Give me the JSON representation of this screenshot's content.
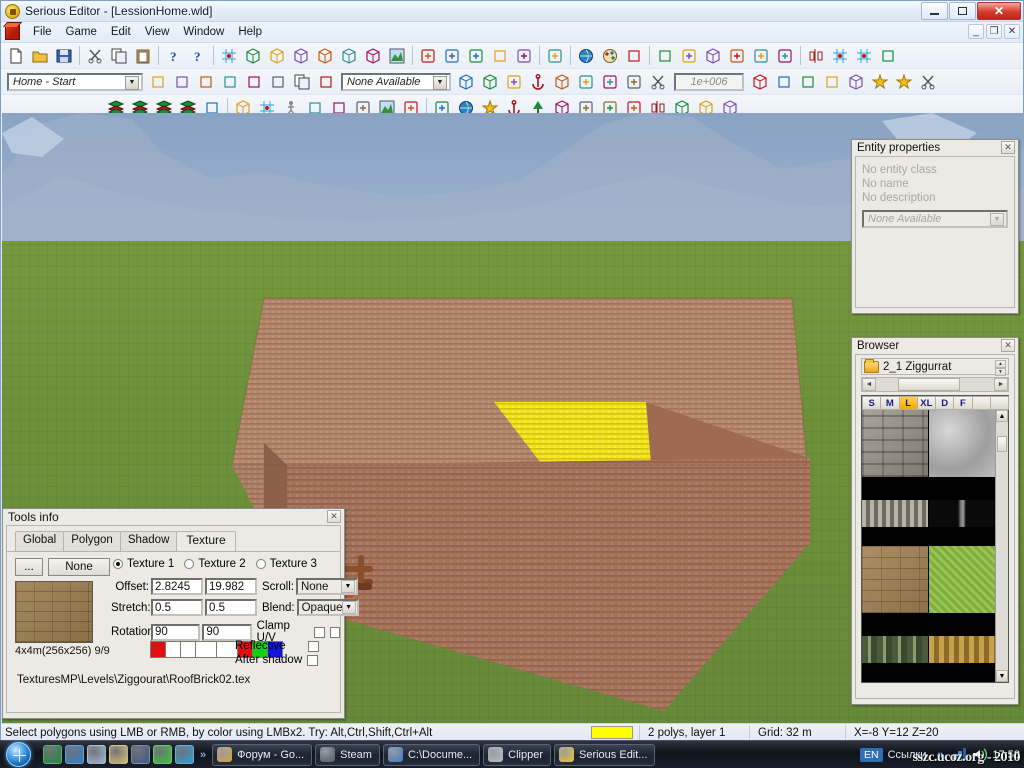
{
  "window": {
    "title": "Serious Editor - [LessionHome.wld]",
    "app_icon": "serious-sam-icon",
    "controls": {
      "minimize": "–",
      "restore": "❐",
      "close": "✕"
    },
    "mdi_controls": {
      "minimize": "_",
      "restore": "❐",
      "close": "✕"
    }
  },
  "menu": {
    "items": [
      "File",
      "Game",
      "Edit",
      "View",
      "Window",
      "Help"
    ]
  },
  "toolbars": {
    "row1": [
      {
        "name": "new-file-icon",
        "glyph": "page"
      },
      {
        "name": "open-file-icon",
        "glyph": "folder"
      },
      {
        "name": "save-file-icon",
        "glyph": "disk"
      },
      {
        "name": "separator"
      },
      {
        "name": "cut-icon",
        "glyph": "scissors"
      },
      {
        "name": "copy-icon",
        "glyph": "copy"
      },
      {
        "name": "paste-icon",
        "glyph": "clipboard"
      },
      {
        "name": "separator"
      },
      {
        "name": "help-icon",
        "glyph": "question"
      },
      {
        "name": "context-help-icon",
        "glyph": "arrow-question"
      },
      {
        "name": "separator"
      },
      {
        "name": "grid-mode-icon",
        "glyph": "grid"
      },
      {
        "name": "vertex-mode-icon",
        "glyph": "vertex"
      },
      {
        "name": "edge-mode-icon",
        "glyph": "edge"
      },
      {
        "name": "polygon-mode-icon",
        "glyph": "poly"
      },
      {
        "name": "sector-mode-icon",
        "glyph": "sector"
      },
      {
        "name": "brush-mode-icon",
        "glyph": "brush"
      },
      {
        "name": "entity-mode-icon",
        "glyph": "entity"
      },
      {
        "name": "terrain-mode-icon",
        "glyph": "terrain"
      },
      {
        "name": "separator"
      },
      {
        "name": "csg-add-icon",
        "glyph": "csg"
      },
      {
        "name": "csg-tool-icon",
        "glyph": "csgtool"
      },
      {
        "name": "measure-icon",
        "glyph": "1m"
      },
      {
        "name": "screenshot-icon",
        "glyph": "camera"
      },
      {
        "name": "render-icon",
        "glyph": "render"
      },
      {
        "name": "separator"
      },
      {
        "name": "shadow-calc-icon",
        "glyph": "shadow"
      },
      {
        "name": "separator"
      },
      {
        "name": "world-icon",
        "glyph": "globe"
      },
      {
        "name": "palette-icon",
        "glyph": "palette"
      },
      {
        "name": "texture-browser-icon",
        "glyph": "texbrowse"
      },
      {
        "name": "separator"
      },
      {
        "name": "view-wire-icon",
        "glyph": "wire1"
      },
      {
        "name": "view-flat-icon",
        "glyph": "flat"
      },
      {
        "name": "view-solid-icon",
        "glyph": "solid"
      },
      {
        "name": "view-textured-icon",
        "glyph": "textured"
      },
      {
        "name": "view-lit-icon",
        "glyph": "lit"
      },
      {
        "name": "view-layout-icon",
        "glyph": "layout"
      },
      {
        "name": "separator"
      },
      {
        "name": "mirror-icon",
        "glyph": "mirror"
      },
      {
        "name": "snap-grid-icon",
        "glyph": "snapgrid"
      },
      {
        "name": "grid-size-icon",
        "glyph": "gridsize"
      },
      {
        "name": "color-select-icon",
        "glyph": "colorsel"
      }
    ],
    "row2": {
      "mode_combo_value": "Home - Start",
      "none_available_combo_value": "None Available",
      "quantity_field_value": "1e+006",
      "buttons": [
        {
          "name": "paint-texture-icon",
          "glyph": "paintbucket"
        },
        {
          "name": "texture-1-icon",
          "glyph": "tex1"
        },
        {
          "name": "texture-2-icon",
          "glyph": "tex2"
        },
        {
          "name": "texture-3-icon",
          "glyph": "tex3"
        },
        {
          "name": "texture-clear-icon",
          "glyph": "texclear"
        },
        {
          "name": "texture-random-icon",
          "glyph": "texrand"
        },
        {
          "name": "texture-copy-icon",
          "glyph": "texcopy"
        },
        {
          "name": "texture-apply-icon",
          "glyph": "texapply"
        },
        {
          "name": "brush-prev-icon",
          "glyph": "bprev"
        },
        {
          "name": "brush-next-icon",
          "glyph": "bnext"
        },
        {
          "name": "layer-icon",
          "glyph": "layer"
        },
        {
          "name": "anchor-tool-icon",
          "glyph": "anchortool"
        },
        {
          "name": "cube-tool-icon",
          "glyph": "cubetool"
        },
        {
          "name": "align-icon",
          "glyph": "align"
        },
        {
          "name": "plane-icon",
          "glyph": "plane"
        },
        {
          "name": "checker-icon",
          "glyph": "checker"
        },
        {
          "name": "scissors2-icon",
          "glyph": "scissors2"
        },
        {
          "name": "entity-place-icon",
          "glyph": "entplace"
        },
        {
          "name": "step-down-icon",
          "glyph": "stepdn"
        },
        {
          "name": "step-up-icon",
          "glyph": "stepup"
        },
        {
          "name": "light-add-icon",
          "glyph": "lightadd"
        },
        {
          "name": "box-light-icon",
          "glyph": "boxlight"
        },
        {
          "name": "spark-icon",
          "glyph": "spark"
        },
        {
          "name": "box-spark-icon",
          "glyph": "boxspark"
        },
        {
          "name": "cut-tool-icon",
          "glyph": "cuttool"
        }
      ]
    },
    "row3": [
      {
        "name": "layers-1-icon",
        "glyph": "layers1"
      },
      {
        "name": "layers-2-icon",
        "glyph": "layers2"
      },
      {
        "name": "layers-3-icon",
        "glyph": "layers3"
      },
      {
        "name": "layers-delete-icon",
        "glyph": "layersdel"
      },
      {
        "name": "paint-can-icon",
        "glyph": "paintcan"
      },
      {
        "name": "separator"
      },
      {
        "name": "new-brush-icon",
        "glyph": "newbrush"
      },
      {
        "name": "color-grid-icon",
        "glyph": "colorgrid"
      },
      {
        "name": "walk-icon",
        "glyph": "walk"
      },
      {
        "name": "select-rect-icon",
        "glyph": "selrect"
      },
      {
        "name": "select-all-icon",
        "glyph": "selall"
      },
      {
        "name": "snap-icon",
        "glyph": "snap"
      },
      {
        "name": "terrain-paint-icon",
        "glyph": "terpaint"
      },
      {
        "name": "align-left-icon",
        "glyph": "alignleft"
      },
      {
        "name": "separator"
      },
      {
        "name": "drop-icon",
        "glyph": "drop"
      },
      {
        "name": "globe-paint-icon",
        "glyph": "globepaint"
      },
      {
        "name": "star-icon",
        "glyph": "star"
      },
      {
        "name": "anchor-icon",
        "glyph": "anchor"
      },
      {
        "name": "tree-icon",
        "glyph": "tree"
      },
      {
        "name": "model-icon",
        "glyph": "model"
      },
      {
        "name": "goto-icon",
        "glyph": "goto"
      },
      {
        "name": "target-icon",
        "glyph": "target"
      },
      {
        "name": "magnet-icon",
        "glyph": "magnet"
      },
      {
        "name": "flip-icon",
        "glyph": "flip"
      },
      {
        "name": "cube-a-icon",
        "glyph": "cubea"
      },
      {
        "name": "cube-b-icon",
        "glyph": "cubeb"
      },
      {
        "name": "cube-c-icon",
        "glyph": "cubec"
      }
    ]
  },
  "entity_properties": {
    "title": "Entity properties",
    "close_label": "✕",
    "lines": [
      "No entity class",
      "No name",
      "No description"
    ],
    "combo_value": "None Available"
  },
  "browser": {
    "title": "Browser",
    "close_label": "✕",
    "folder_name": "2_1 Ziggurrat",
    "size_buttons": [
      "S",
      "M",
      "L",
      "XL",
      "D",
      "F"
    ],
    "active_size": "L",
    "scroll_left": "◄",
    "scroll_right": "►",
    "thumbnails": [
      {
        "name": "stone-wall-texture",
        "selected": false
      },
      {
        "name": "gray-marble-texture",
        "selected": false
      },
      {
        "name": "ornament-trim-texture",
        "selected": false
      },
      {
        "name": "dark-pillar-texture",
        "selected": false
      },
      {
        "name": "roof-brick-texture",
        "selected": true
      },
      {
        "name": "green-grass-texture",
        "selected": false
      },
      {
        "name": "arch-wall-texture",
        "selected": false
      },
      {
        "name": "gold-relief-texture",
        "selected": false
      },
      {
        "name": "wood-floor-texture",
        "selected": false
      },
      {
        "name": "gray-rock-texture",
        "selected": false
      }
    ]
  },
  "tools_info": {
    "title": "Tools info",
    "close_label": "✕",
    "tabs": [
      "Global",
      "Polygon",
      "Shadow",
      "Texture"
    ],
    "active_tab": "Texture",
    "browse_button": "...",
    "none_button": "None",
    "texture_radios": [
      "Texture 1",
      "Texture 2",
      "Texture 3"
    ],
    "active_texture_radio": "Texture 1",
    "offset_label": "Offset:",
    "offset_u": "2.8245",
    "offset_v": "19.982",
    "stretch_label": "Stretch:",
    "stretch_u": "0.5",
    "stretch_v": "0.5",
    "rotation_label": "Rotation:",
    "rotation_u": "90",
    "rotation_v": "90",
    "scroll_label": "Scroll:",
    "scroll_value": "None",
    "blend_label": "Blend:",
    "blend_value": "Opaque",
    "clamp_label": "Clamp U/V",
    "reflective_label": "Reflective",
    "after_shadow_label": "After shadow",
    "texture_size_info": "4x4m(256x256) 9/9",
    "texture_path": "TexturesMP\\Levels\\Ziggourat\\RoofBrick02.tex",
    "swatch_colors": [
      "#e01010",
      "#ffffff",
      "#ffffff",
      "#ffffff",
      "#ffffff",
      "#e01010",
      "#12d012",
      "#1414e0"
    ]
  },
  "viewport": {
    "name": "3d-viewport",
    "sky_color": "#93aac8",
    "ground_color": "#6d9139",
    "building_roof_color": "#b08068",
    "building_wall_color": "#a4735c",
    "selected_polygon_color": "#f2e31a"
  },
  "statusbar": {
    "message": "Select polygons using LMB or RMB, by color using LMBx2. Try: Alt,Ctrl,Shift,Ctrl+Alt",
    "color_swatch": "#ffff00",
    "polys": "2 polys, layer 1",
    "grid": "Grid: 32 m",
    "coords": "X=-8 Y=12 Z=20"
  },
  "taskbar": {
    "start_label": "start-orb",
    "quick_launch": [
      "utorrent-icon",
      "internet-explorer-icon",
      "photo-viewer-icon",
      "notepad-icon",
      "show-desktop-icon",
      "flower-icon",
      "skype-icon"
    ],
    "overflow_chevron": "»",
    "tasks": [
      {
        "label": "Форум - Go...",
        "icon": "chrome-icon",
        "color": "#d8a23c"
      },
      {
        "label": "Steam",
        "icon": "steam-icon",
        "color": "#4d5a64"
      },
      {
        "label": "C:\\Docume...",
        "icon": "explorer-icon",
        "color": "#3b7dc4"
      },
      {
        "label": "Clipper",
        "icon": "clipper-icon",
        "color": "#b8bcc2"
      },
      {
        "label": "Serious Edit...",
        "icon": "serious-sam-icon",
        "color": "#f2c32c"
      }
    ],
    "language": "EN",
    "tray_label": "Ссылки",
    "tray_chevron": "»",
    "tray_icons": [
      "network-icon",
      "volume-icon"
    ],
    "clock": "17:58",
    "watermark": "sszc.ucoz.org - 2010"
  }
}
